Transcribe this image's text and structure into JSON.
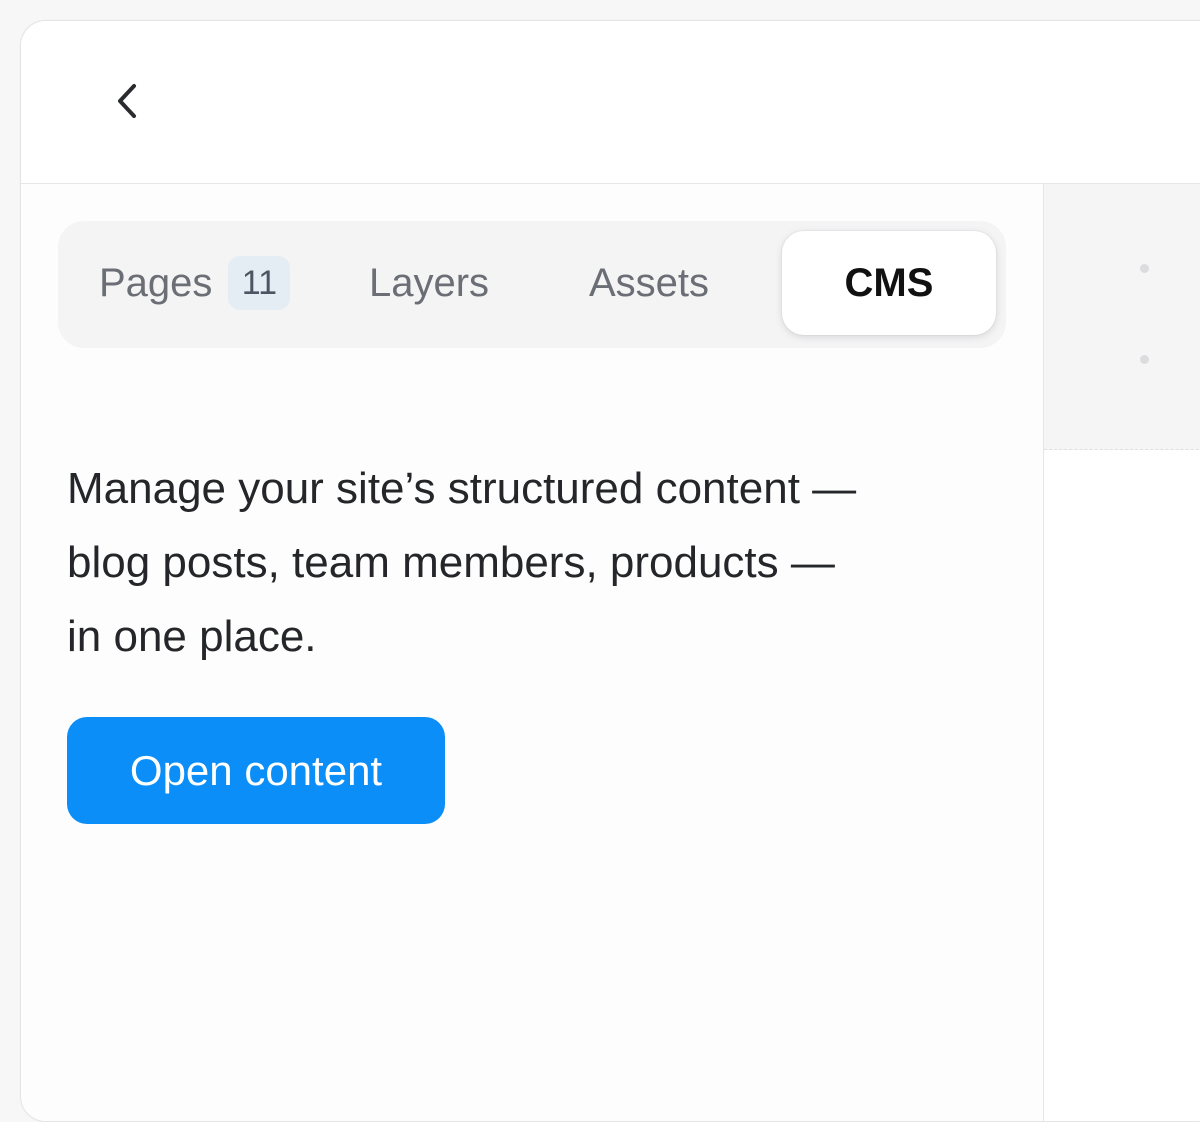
{
  "header": {
    "back_icon": "chevron-left-icon"
  },
  "tabs": {
    "pages": {
      "label": "Pages",
      "count": "11"
    },
    "layers": {
      "label": "Layers"
    },
    "assets": {
      "label": "Assets"
    },
    "cms": {
      "label": "CMS",
      "selected": true
    }
  },
  "cms_panel": {
    "description_line1": "Manage your site’s structured content —",
    "description_line2": "blog posts, team members, products —",
    "description_line3": "in one place.",
    "open_button_label": "Open content"
  },
  "colors": {
    "accent": "#0b8ef7",
    "badge_bg": "#e4ecf4",
    "tabbar_bg": "#f4f4f5",
    "text": "#252629"
  }
}
